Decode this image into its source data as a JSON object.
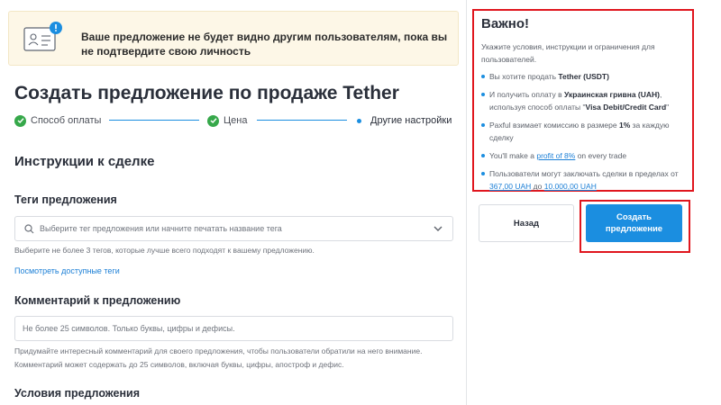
{
  "banner": {
    "message": "Ваше предложение не будет видно другим пользователям, пока вы не подтвердите свою личность"
  },
  "page_title": "Создать предложение по продаже Tether",
  "stepper": {
    "steps": [
      {
        "label": "Способ оплаты",
        "state": "done"
      },
      {
        "label": "Цена",
        "state": "done"
      },
      {
        "label": "Другие настройки",
        "state": "current"
      }
    ]
  },
  "instructions": {
    "section_title": "Инструкции к сделке",
    "tags": {
      "label": "Теги предложения",
      "placeholder": "Выберите тег предложения или начните печатать название тега",
      "hint": "Выберите не более 3 тегов, которые лучше всего подходят к вашему предложению.",
      "link": "Посмотреть доступные теги"
    },
    "comment": {
      "label": "Комментарий к предложению",
      "placeholder": "Не более 25 символов. Только буквы, цифры и дефисы.",
      "hint_line1": "Придумайте интересный комментарий для своего предложения, чтобы пользователи обратили на него внимание.",
      "hint_line2": "Комментарий может содержать до 25 символов, включая буквы, цифры, апостроф и дефис."
    },
    "terms_label": "Условия предложения"
  },
  "info": {
    "title": "Важно!",
    "description": "Укажите условия, инструкции и ограничения для пользователей.",
    "items": {
      "sell_prefix": "Вы хотите продать ",
      "sell_asset": "Tether (USDT)",
      "receive_prefix": "И получить оплату в ",
      "receive_currency": "Украинская гривна (UAH)",
      "receive_mid": ", используя способ оплаты \"",
      "payment_method": "Visa Debit/Credit Card",
      "receive_suffix": "\"",
      "fee_prefix": "Paxful взимает комиссию в размере ",
      "fee_value": "1%",
      "fee_suffix": " за каждую сделку",
      "profit_prefix": "You'll make a ",
      "profit_link": "profit of 8%",
      "profit_suffix": " on every trade",
      "limits_prefix": "Пользователи могут заключать сделки в пределах от ",
      "limit_min": "367,00 UAH",
      "limits_mid": " до ",
      "limit_max": "10.000,00 UAH"
    }
  },
  "buttons": {
    "back": "Назад",
    "create": "Создать предложение"
  },
  "colors": {
    "accent": "#1b8ee0",
    "success": "#36a84a",
    "highlight": "#e0161e",
    "banner_bg": "#fdf7e7"
  }
}
